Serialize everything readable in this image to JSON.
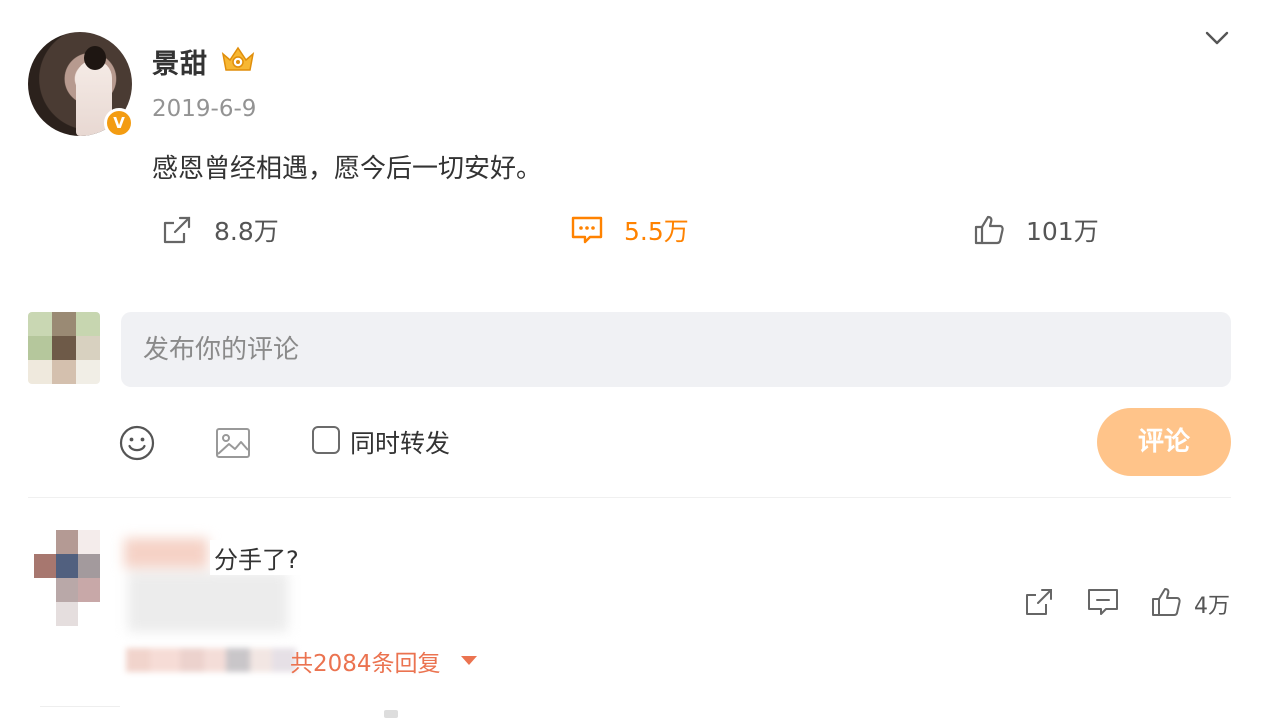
{
  "post": {
    "username": "景甜",
    "date": "2019-6-9",
    "text": "感恩曾经相遇，愿今后一切安好。",
    "verified_badge": "V",
    "icons": {
      "vip": "crown-vip-icon",
      "menu": "chevron-down-icon",
      "verified": "verified-badge-icon"
    }
  },
  "stats": {
    "shares": "8.8万",
    "comments": "5.5万",
    "likes": "101万"
  },
  "composer": {
    "placeholder": "发布你的评论",
    "repost_label": "同时转发",
    "repost_checked": false,
    "submit_label": "评论",
    "icons": [
      "emoji-icon",
      "image-icon"
    ]
  },
  "comments": [
    {
      "text": "分手了?",
      "likes": "4万",
      "replies_label": "共2084条回复"
    }
  ],
  "colors": {
    "accent_orange": "#ff8200",
    "submit_button": "#ffc48a",
    "reply_link": "#eb7350",
    "input_bg": "#f0f1f4",
    "meta_gray": "#939393"
  }
}
